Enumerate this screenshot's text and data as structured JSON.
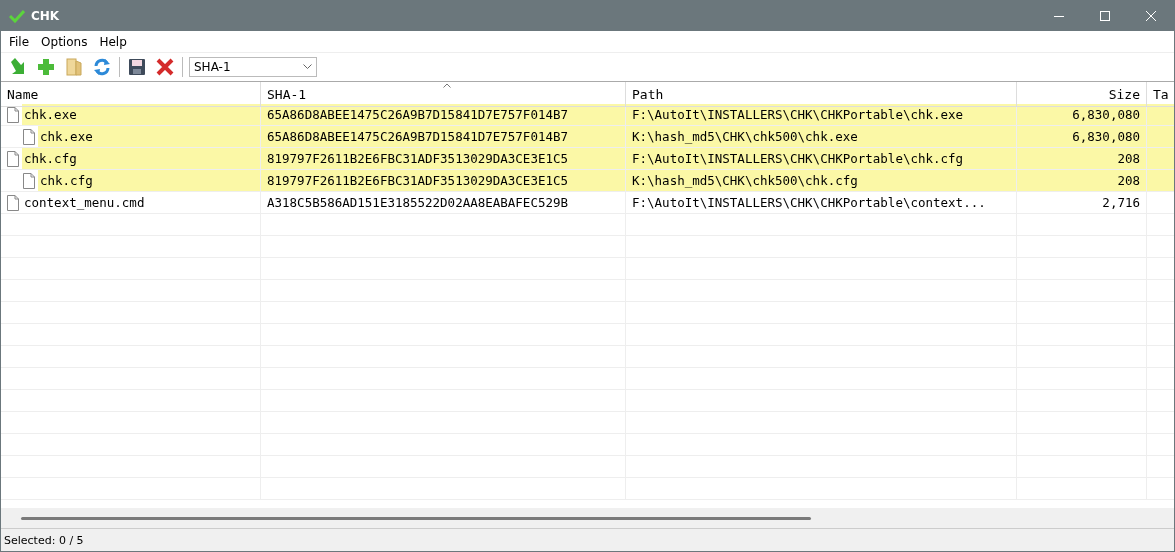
{
  "window": {
    "title": "CHK"
  },
  "menu": [
    "File",
    "Options",
    "Help"
  ],
  "toolbar": {
    "hash_select": {
      "value": "SHA-1"
    }
  },
  "table": {
    "columns": [
      {
        "label": "Name",
        "sorted": false
      },
      {
        "label": "SHA-1",
        "sorted": true
      },
      {
        "label": "Path",
        "sorted": false
      },
      {
        "label": "Size",
        "sorted": false
      },
      {
        "label": "Ta",
        "sorted": false
      }
    ],
    "rows": [
      {
        "name": "chk.exe",
        "hash": "65A86D8ABEE1475C26A9B7D15841D7E757F014B7",
        "path": "F:\\AutoIt\\INSTALLERS\\CHK\\CHKPortable\\chk.exe",
        "size": "6,830,080",
        "highlighted": true,
        "children": [
          {
            "name": "chk.exe",
            "hash": "65A86D8ABEE1475C26A9B7D15841D7E757F014B7",
            "path": "K:\\hash_md5\\CHK\\chk500\\chk.exe",
            "size": "6,830,080",
            "highlighted": true
          }
        ]
      },
      {
        "name": "chk.cfg",
        "hash": "819797F2611B2E6FBC31ADF3513029DA3CE3E1C5",
        "path": "F:\\AutoIt\\INSTALLERS\\CHK\\CHKPortable\\chk.cfg",
        "size": "208",
        "highlighted": true,
        "children": [
          {
            "name": "chk.cfg",
            "hash": "819797F2611B2E6FBC31ADF3513029DA3CE3E1C5",
            "path": "K:\\hash_md5\\CHK\\chk500\\chk.cfg",
            "size": "208",
            "highlighted": true
          }
        ]
      },
      {
        "name": "context_menu.cmd",
        "hash": "A318C5B586AD151E3185522D02AA8EABAFEC529B",
        "path": "F:\\AutoIt\\INSTALLERS\\CHK\\CHKPortable\\context...",
        "size": "2,716",
        "highlighted": false
      }
    ]
  },
  "status_bar": {
    "text": "Selected: 0 / 5"
  }
}
